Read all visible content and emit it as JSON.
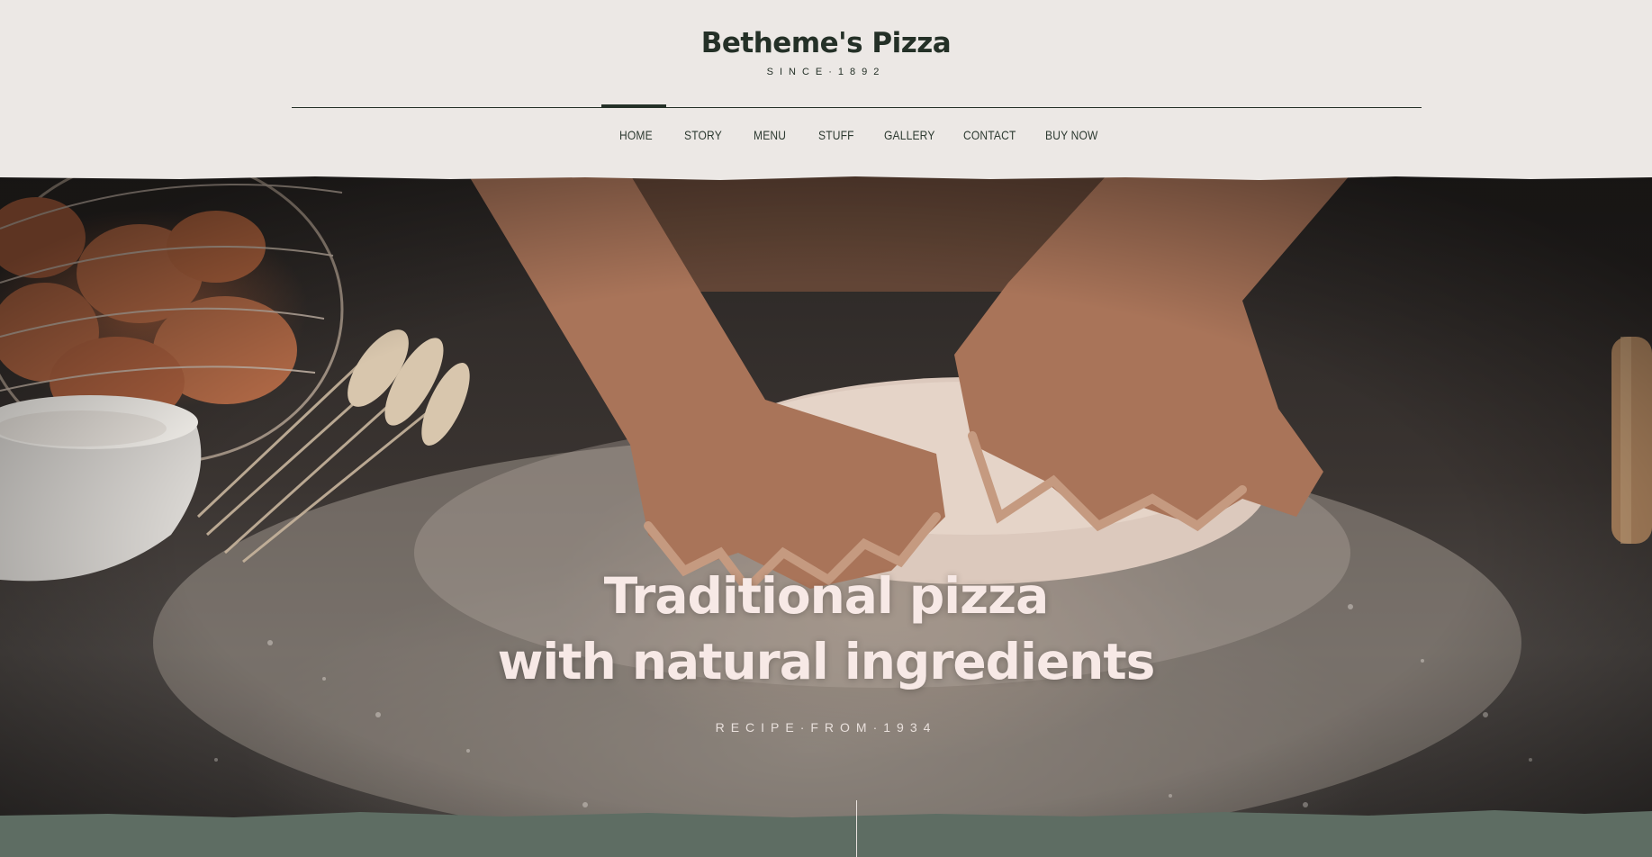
{
  "site": {
    "title": "Betheme's Pizza",
    "tagline": "SINCE·1892"
  },
  "nav": {
    "items": [
      {
        "label": "HOME",
        "active": true
      },
      {
        "label": "STORY",
        "active": false
      },
      {
        "label": "MENU",
        "active": false
      },
      {
        "label": "STUFF",
        "active": false
      },
      {
        "label": "GALLERY",
        "active": false
      },
      {
        "label": "CONTACT",
        "active": false
      },
      {
        "label": "BUY NOW",
        "active": false
      }
    ]
  },
  "hero": {
    "title_line1": "Traditional pizza",
    "title_line2": "with natural ingredients",
    "subtitle": "RECIPE·FROM·1934",
    "image_icon": "hands-kneading-dough-photo"
  },
  "colors": {
    "background": "#ece8e5",
    "text_dark": "#243027",
    "hero_text": "#f7e9e6",
    "footer_strip": "#5e6d63"
  }
}
